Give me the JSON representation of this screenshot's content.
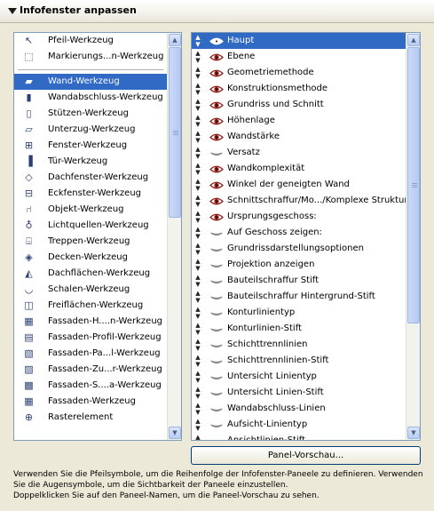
{
  "panel": {
    "title": "Infofenster anpassen"
  },
  "tools": [
    {
      "label": "Pfeil-Werkzeug",
      "icon": "arrow-pointer-icon",
      "glyph": "↖"
    },
    {
      "label": "Markierungs...n-Werkzeug",
      "icon": "marquee-icon",
      "glyph": "⬚"
    },
    {
      "separator": true
    },
    {
      "label": "Wand-Werkzeug",
      "icon": "wall-tool-icon",
      "glyph": "▰",
      "selected": true
    },
    {
      "label": "Wandabschluss-Werkzeug",
      "icon": "wall-end-icon",
      "glyph": "▮"
    },
    {
      "label": "Stützen-Werkzeug",
      "icon": "column-icon",
      "glyph": "▯"
    },
    {
      "label": "Unterzug-Werkzeug",
      "icon": "beam-icon",
      "glyph": "▱"
    },
    {
      "label": "Fenster-Werkzeug",
      "icon": "window-icon",
      "glyph": "⊞"
    },
    {
      "label": "Tür-Werkzeug",
      "icon": "door-icon",
      "glyph": "▐"
    },
    {
      "label": "Dachfenster-Werkzeug",
      "icon": "skylight-icon",
      "glyph": "◇"
    },
    {
      "label": "Eckfenster-Werkzeug",
      "icon": "corner-window-icon",
      "glyph": "⊟"
    },
    {
      "label": "Objekt-Werkzeug",
      "icon": "object-chair-icon",
      "glyph": "⑁"
    },
    {
      "label": "Lichtquellen-Werkzeug",
      "icon": "lamp-icon",
      "glyph": "♁"
    },
    {
      "label": "Treppen-Werkzeug",
      "icon": "stair-icon",
      "glyph": "⌸"
    },
    {
      "label": "Decken-Werkzeug",
      "icon": "slab-icon",
      "glyph": "◈"
    },
    {
      "label": "Dachflächen-Werkzeug",
      "icon": "roof-icon",
      "glyph": "◭"
    },
    {
      "label": "Schalen-Werkzeug",
      "icon": "shell-icon",
      "glyph": "◡"
    },
    {
      "label": "Freiflächen-Werkzeug",
      "icon": "mesh-icon",
      "glyph": "◫"
    },
    {
      "label": "Fassaden-H....n-Werkzeug",
      "icon": "curtainwall-icon",
      "glyph": "▦"
    },
    {
      "label": "Fassaden-Profil-Werkzeug",
      "icon": "curtainwall-frame-icon",
      "glyph": "▤"
    },
    {
      "label": "Fassaden-Pa...l-Werkzeug",
      "icon": "curtainwall-panel-icon",
      "glyph": "▧"
    },
    {
      "label": "Fassaden-Zu...r-Werkzeug",
      "icon": "curtainwall-accessory-icon",
      "glyph": "▨"
    },
    {
      "label": "Fassaden-S....a-Werkzeug",
      "icon": "curtainwall-scheme-icon",
      "glyph": "▩"
    },
    {
      "label": "Fassaden-Werkzeug",
      "icon": "curtainwall-tool-icon",
      "glyph": "▦"
    },
    {
      "label": "Rasterelement",
      "icon": "grid-element-icon",
      "glyph": "⊕"
    }
  ],
  "panels": [
    {
      "label": "Haupt",
      "visible": true,
      "selected": true
    },
    {
      "label": "Ebene",
      "visible": true
    },
    {
      "label": "Geometriemethode",
      "visible": true
    },
    {
      "label": "Konstruktionsmethode",
      "visible": true
    },
    {
      "label": "Grundriss und Schnitt",
      "visible": true
    },
    {
      "label": "Höhenlage",
      "visible": true
    },
    {
      "label": "Wandstärke",
      "visible": true
    },
    {
      "label": "Versatz",
      "visible": false
    },
    {
      "label": "Wandkomplexität",
      "visible": true
    },
    {
      "label": "Winkel der geneigten Wand",
      "visible": true
    },
    {
      "label": "Schnittschraffur/Mo.../Komplexe Struktur",
      "visible": true
    },
    {
      "label": "Ursprungsgeschoss:",
      "visible": true
    },
    {
      "label": "Auf Geschoss zeigen:",
      "visible": false
    },
    {
      "label": "Grundrissdarstellungsoptionen",
      "visible": false
    },
    {
      "label": "Projektion anzeigen",
      "visible": false
    },
    {
      "label": "Bauteilschraffur Stift",
      "visible": false
    },
    {
      "label": "Bauteilschraffur Hintergrund-Stift",
      "visible": false
    },
    {
      "label": "Konturlinientyp",
      "visible": false
    },
    {
      "label": "Konturlinien-Stift",
      "visible": false
    },
    {
      "label": "Schichttrennlinien",
      "visible": false
    },
    {
      "label": "Schichttrennlinien-Stift",
      "visible": false
    },
    {
      "label": "Untersicht Linientyp",
      "visible": false
    },
    {
      "label": "Untersicht Linien-Stift",
      "visible": false
    },
    {
      "label": "Wandabschluss-Linien",
      "visible": false
    },
    {
      "label": "Aufsicht-Linientyp",
      "visible": false
    },
    {
      "label": "Ansichtlinien-Stift",
      "visible": false
    }
  ],
  "preview_button": "Panel-Vorschau...",
  "hint_lines": [
    "Verwenden Sie die Pfeilsymbole, um die Reihenfolge der Infofenster-Paneele zu definieren. Verwenden",
    "Sie die Augensymbole, um die Sichtbarkeit der Paneele einzustellen.",
    "Doppelklicken Sie auf den Paneel-Namen, um die Paneel-Vorschau zu sehen."
  ],
  "colors": {
    "selection": "#316ac5",
    "eye_open": "#8b1a10",
    "eye_closed": "#9a9a9a"
  },
  "left_scroll": {
    "thumb_start": 0.0,
    "thumb_fraction": 0.45
  },
  "right_scroll": {
    "thumb_start": 0.0,
    "thumb_fraction": 0.73
  }
}
